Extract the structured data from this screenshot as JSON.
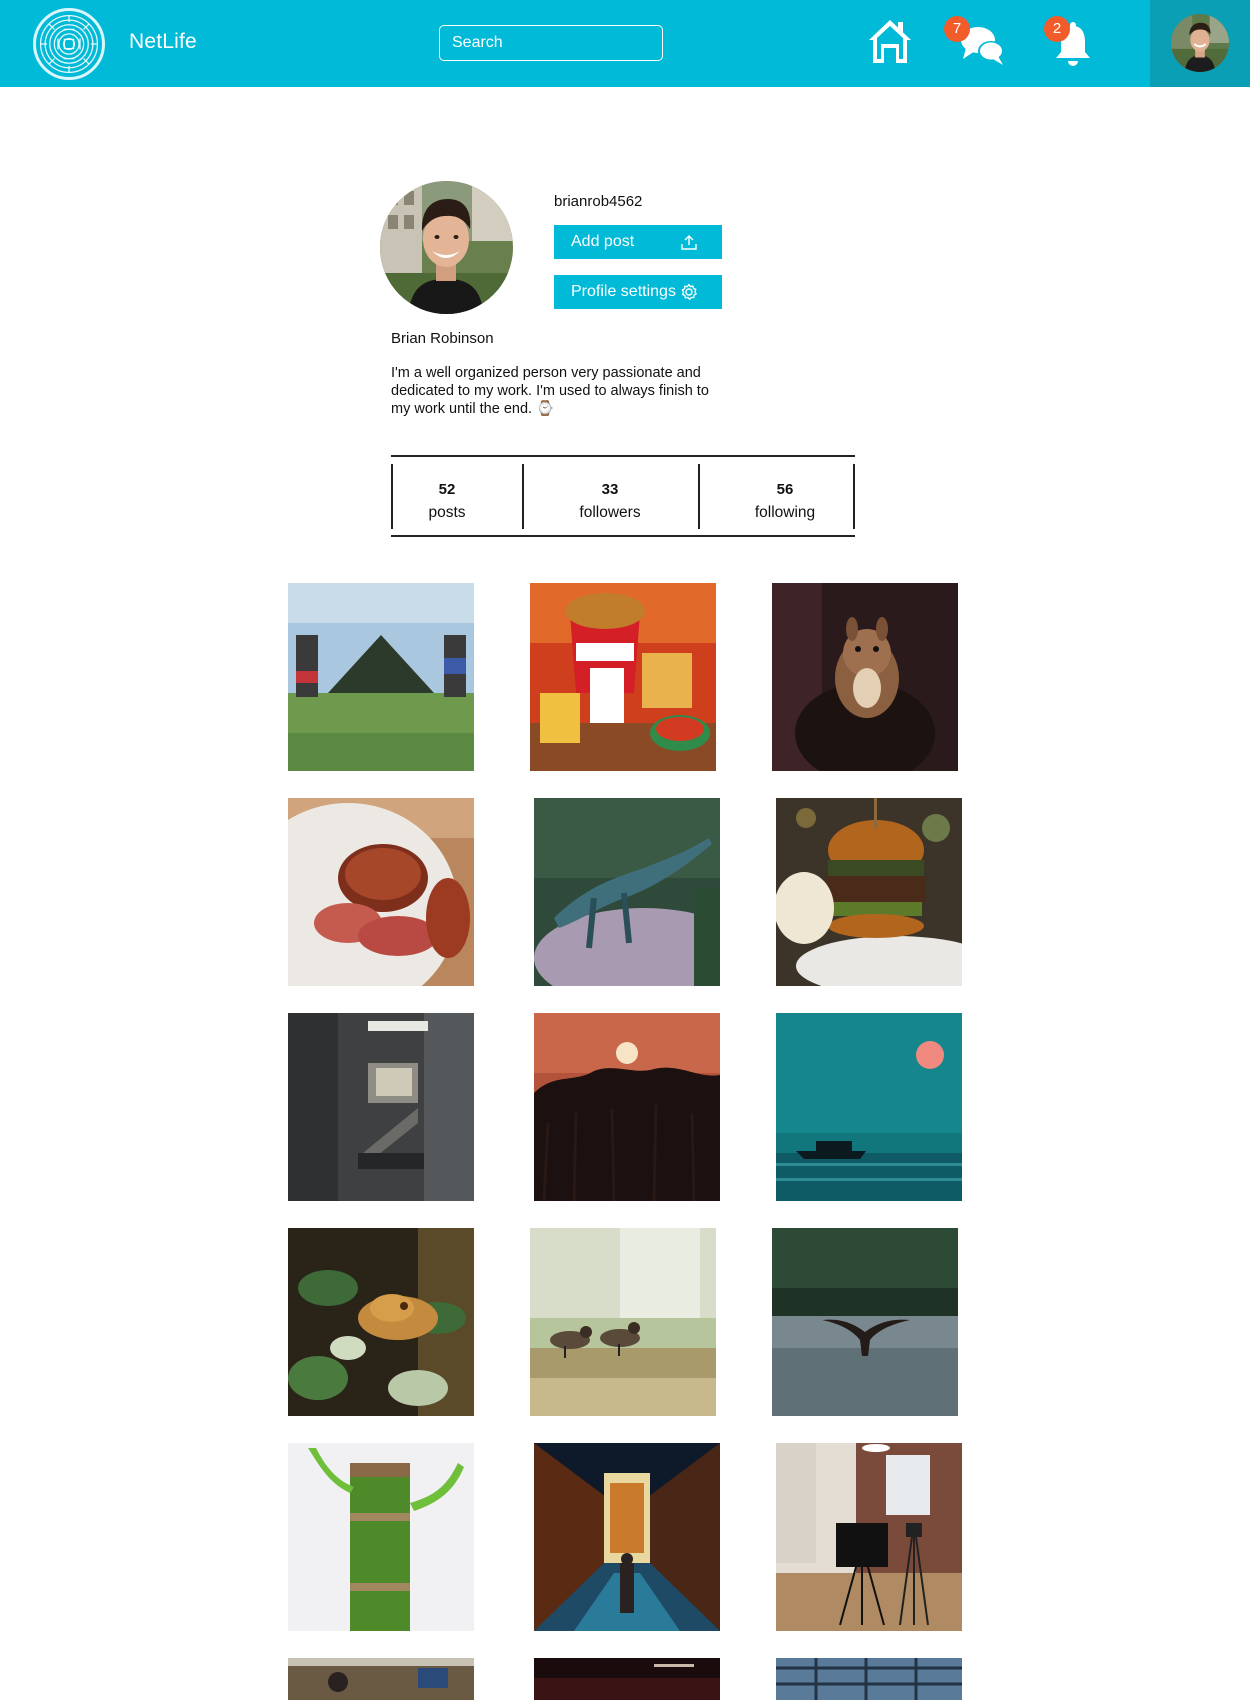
{
  "app": {
    "brand": "NetLife",
    "accent": "#00BAD7",
    "badge_color": "#F25C2A"
  },
  "header": {
    "search_placeholder": "Search",
    "icons": [
      "logo-icon",
      "home-icon",
      "chat-icon",
      "bell-icon"
    ],
    "messages_badge": "7",
    "notifications_badge": "2"
  },
  "profile": {
    "username": "brianrob4562",
    "full_name": "Brian Robinson",
    "bio": "I'm a well organized person very passionate and dedicated to my work. I'm used to always finish to my work until the end. ⌚",
    "add_post_label": "Add post",
    "settings_label": "Profile settings"
  },
  "stats": {
    "posts": {
      "value": "52",
      "label": "posts"
    },
    "followers": {
      "value": "33",
      "label": "followers"
    },
    "following": {
      "value": "56",
      "label": "following"
    }
  },
  "photos": [
    "festival-stage",
    "fried-chicken-bucket",
    "squirrel",
    "roast-meat",
    "lizard",
    "burger",
    "stairwell",
    "sunset-forest",
    "sea-sunset-boat",
    "gecko",
    "birds",
    "whale-tail",
    "bamboo",
    "neon-street",
    "studio-camera",
    "cafe",
    "dark-room",
    "building-window"
  ]
}
